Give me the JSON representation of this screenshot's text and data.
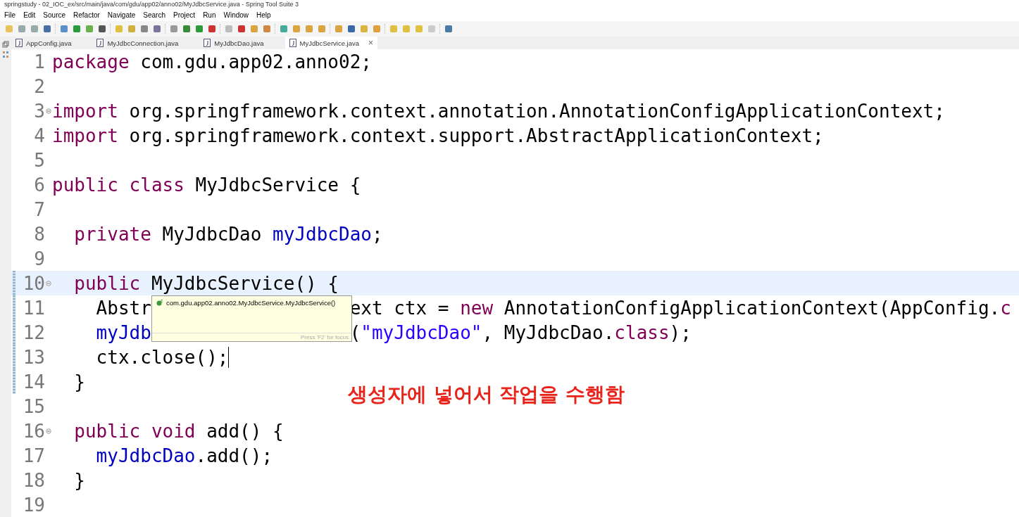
{
  "window": {
    "title": "springstudy - 02_IOC_ex/src/main/java/com/gdu/app02/anno02/MyJdbcService.java - Spring Tool Suite 3"
  },
  "menu": [
    "File",
    "Edit",
    "Source",
    "Refactor",
    "Navigate",
    "Search",
    "Project",
    "Run",
    "Window",
    "Help"
  ],
  "tabs": [
    {
      "label": "AppConfig.java",
      "selected": false
    },
    {
      "label": "MyJdbcConnection.java",
      "selected": false
    },
    {
      "label": "MyJdbcDao.java",
      "selected": false
    },
    {
      "label": "MyJdbcService.java",
      "selected": true,
      "close": "×"
    }
  ],
  "editor": {
    "lines": [
      {
        "number": "1",
        "current": false,
        "changed": false,
        "fold": false,
        "tokens": [
          {
            "kind": "keyword",
            "text": "package"
          },
          {
            "kind": "plain",
            "text": " com.gdu.app02.anno02;"
          }
        ]
      },
      {
        "number": "2",
        "current": false,
        "changed": false,
        "fold": false
      },
      {
        "number": "3",
        "current": false,
        "changed": false,
        "fold": true,
        "tokens": [
          {
            "kind": "keyword",
            "text": "import"
          },
          {
            "kind": "plain",
            "text": " org.springframework.context.annotation.AnnotationConfigApplicationContext;"
          }
        ]
      },
      {
        "number": "4",
        "current": false,
        "changed": false,
        "fold": false,
        "tokens": [
          {
            "kind": "keyword",
            "text": "import"
          },
          {
            "kind": "plain",
            "text": " org.springframework.context.support.AbstractApplicationContext;"
          }
        ]
      },
      {
        "number": "5",
        "current": false,
        "changed": false,
        "fold": false
      },
      {
        "number": "6",
        "current": false,
        "changed": false,
        "fold": false,
        "tokens": [
          {
            "kind": "keyword",
            "text": "public class"
          },
          {
            "kind": "plain",
            "text": " MyJdbcService {"
          }
        ]
      },
      {
        "number": "7",
        "current": false,
        "changed": false,
        "fold": false
      },
      {
        "number": "8",
        "current": false,
        "changed": false,
        "fold": false,
        "tokens": [
          {
            "kind": "keyword",
            "text": "  private"
          },
          {
            "kind": "plain",
            "text": " MyJdbcDao "
          },
          {
            "kind": "field",
            "text": "myJdbcDao"
          },
          {
            "kind": "plain",
            "text": ";"
          }
        ]
      },
      {
        "number": "9",
        "current": false,
        "changed": false,
        "fold": false
      },
      {
        "number": "10",
        "current": true,
        "changed": true,
        "fold": true,
        "tokens": [
          {
            "kind": "keyword",
            "text": "  public"
          },
          {
            "kind": "plain",
            "text": " MyJdbcService() {"
          }
        ]
      },
      {
        "number": "11",
        "current": false,
        "changed": true,
        "fold": false,
        "tokens": [
          {
            "kind": "plain",
            "text": "    Abstr"
          },
          {
            "kind": "covered"
          },
          {
            "kind": "plain",
            "text": "ext ctx = "
          },
          {
            "kind": "keyword",
            "text": "new"
          },
          {
            "kind": "plain",
            "text": " AnnotationConfigApplicationContext(AppConfig."
          },
          {
            "kind": "keyword",
            "text": "c"
          }
        ]
      },
      {
        "number": "12",
        "current": false,
        "changed": true,
        "fold": false,
        "tokens": [
          {
            "kind": "field",
            "text": "    myJdb"
          },
          {
            "kind": "covered"
          },
          {
            "kind": "plain",
            "text": "("
          },
          {
            "kind": "string",
            "text": "\"myJdbcDao\""
          },
          {
            "kind": "plain",
            "text": ", MyJdbcDao."
          },
          {
            "kind": "keyword",
            "text": "class"
          },
          {
            "kind": "plain",
            "text": ");"
          }
        ]
      },
      {
        "number": "13",
        "current": false,
        "changed": true,
        "fold": false,
        "caret": true,
        "tokens": [
          {
            "kind": "plain",
            "text": "    ctx.close();"
          }
        ]
      },
      {
        "number": "14",
        "current": false,
        "changed": true,
        "fold": false,
        "tokens": [
          {
            "kind": "plain",
            "text": "  }"
          }
        ]
      },
      {
        "number": "15",
        "current": false,
        "changed": false,
        "fold": false
      },
      {
        "number": "16",
        "current": false,
        "changed": false,
        "fold": true,
        "tokens": [
          {
            "kind": "keyword",
            "text": "  public void"
          },
          {
            "kind": "plain",
            "text": " add() {"
          }
        ]
      },
      {
        "number": "17",
        "current": false,
        "changed": false,
        "fold": false,
        "tokens": [
          {
            "kind": "field",
            "text": "    myJdbcDao"
          },
          {
            "kind": "plain",
            "text": ".add();"
          }
        ]
      },
      {
        "number": "18",
        "current": false,
        "changed": false,
        "fold": false,
        "tokens": [
          {
            "kind": "plain",
            "text": "  }"
          }
        ]
      },
      {
        "number": "19",
        "current": false,
        "changed": false,
        "fold": false
      }
    ]
  },
  "tooltip": {
    "text": "com.gdu.app02.anno02.MyJdbcService.MyJdbcService()",
    "hint": "Press 'F2' for focus"
  },
  "annotation": "생성자에 넣어서 작업을 수행함"
}
